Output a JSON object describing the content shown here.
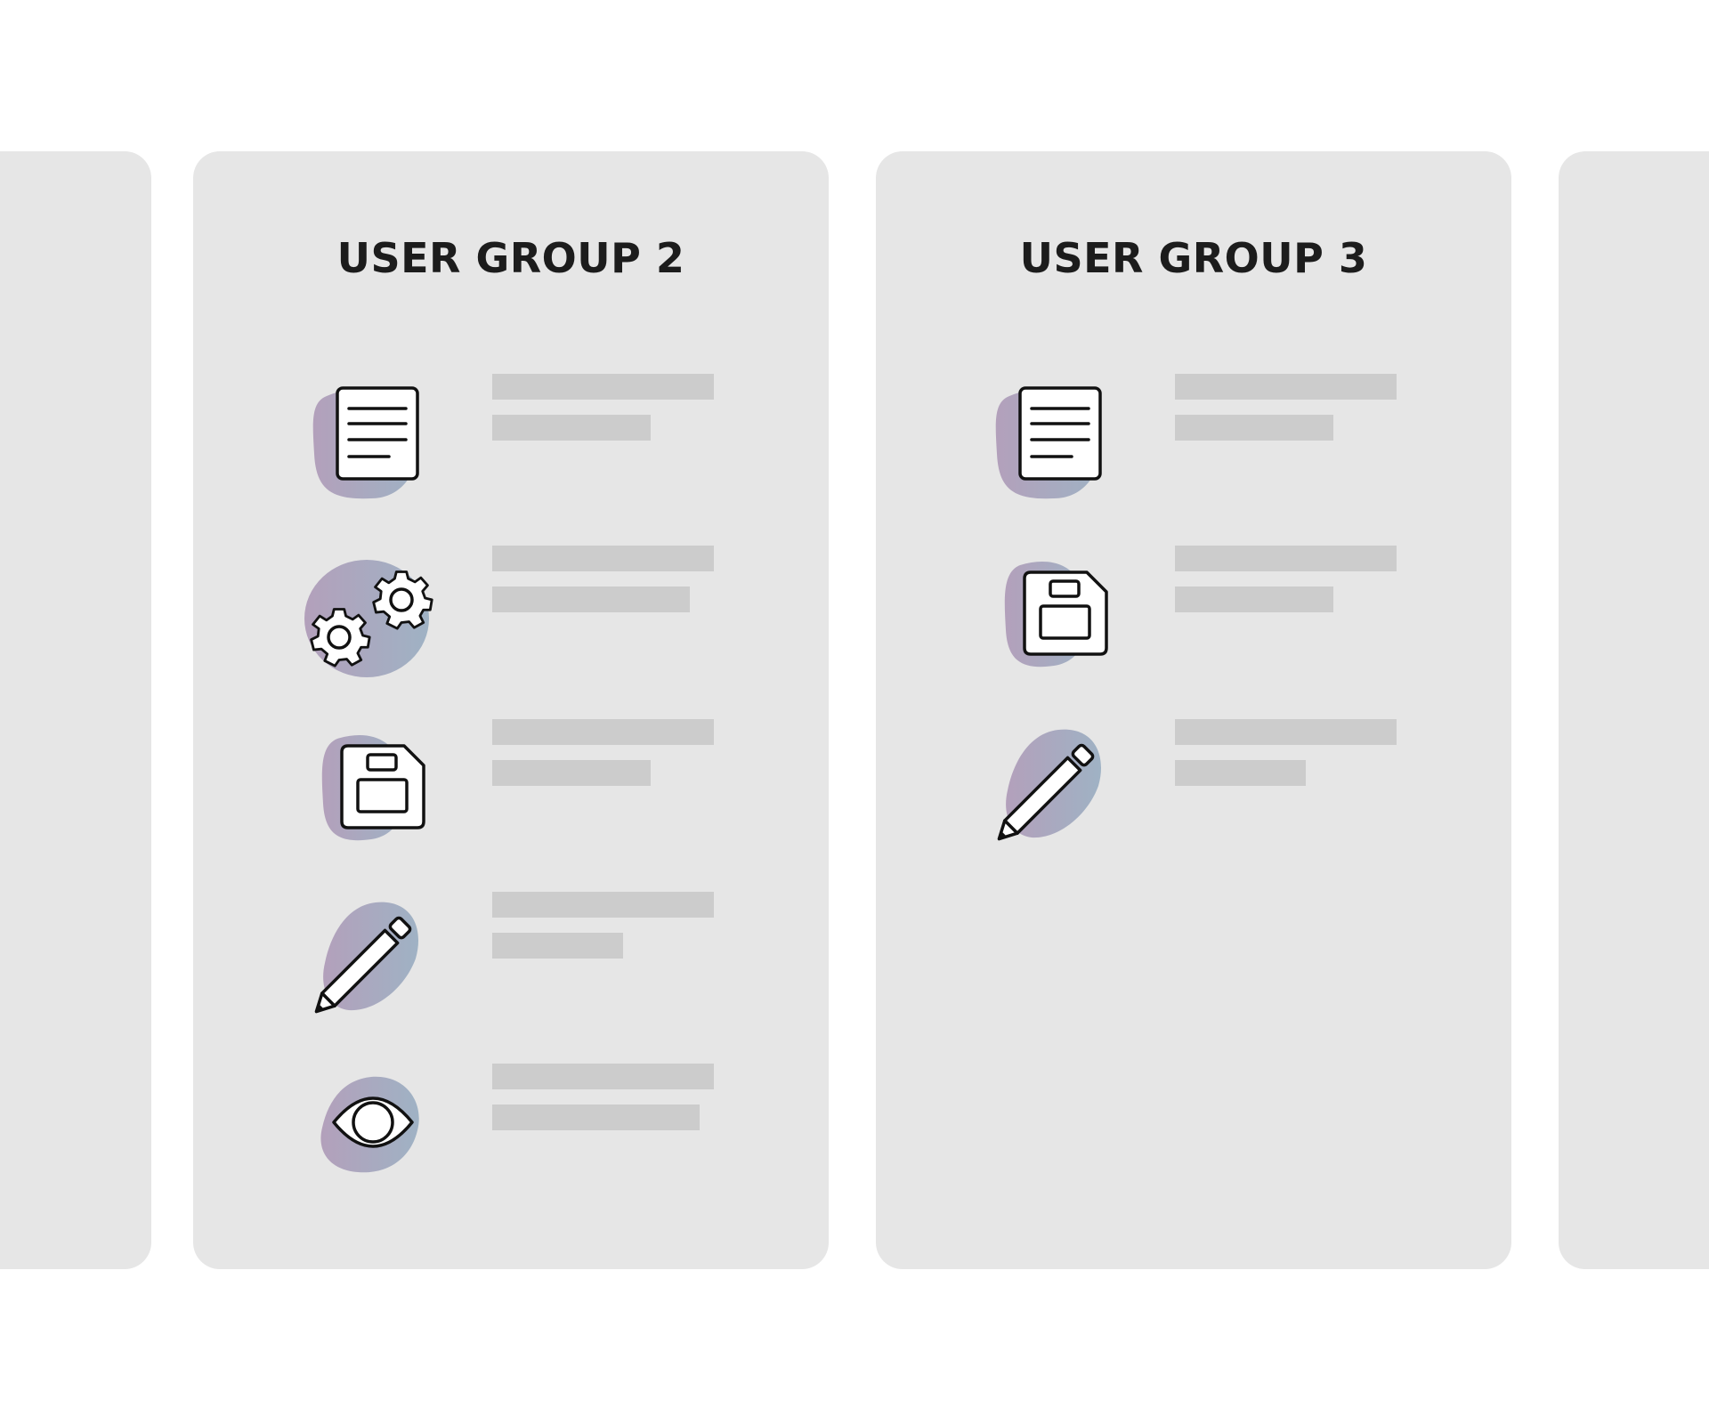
{
  "colors": {
    "page_background": "#ffffff",
    "card_background": "#e6e6e6",
    "placeholder_bar": "#cccccc",
    "title_text": "#1c1c1c",
    "icon_stroke": "#111111",
    "icon_fill": "#ffffff",
    "blob_gradient_start": "#b3a0bb",
    "blob_gradient_end": "#9fb2c4"
  },
  "groups": [
    {
      "title": "",
      "items": []
    },
    {
      "title": "USER GROUP 2",
      "items": [
        {
          "icon": "document-icon"
        },
        {
          "icon": "gears-icon"
        },
        {
          "icon": "floppy-disk-icon"
        },
        {
          "icon": "pencil-icon"
        },
        {
          "icon": "eye-icon"
        }
      ]
    },
    {
      "title": "USER GROUP 3",
      "items": [
        {
          "icon": "document-icon"
        },
        {
          "icon": "floppy-disk-icon"
        },
        {
          "icon": "pencil-icon"
        }
      ]
    },
    {
      "title": "",
      "items": []
    }
  ]
}
